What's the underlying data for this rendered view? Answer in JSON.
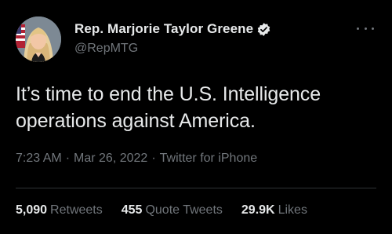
{
  "tweet": {
    "author": {
      "display_name": "Rep. Marjorie Taylor Greene",
      "handle": "@RepMTG",
      "verified_icon": "verified-badge-icon",
      "avatar_icon": "profile-photo"
    },
    "more_icon": "more-options-icon",
    "text": "It’s time to end the U.S. Intelligence operations against America.",
    "meta": {
      "time": "7:23 AM",
      "date": "Mar 26, 2022",
      "source": "Twitter for iPhone",
      "separator": "·"
    },
    "stats": [
      {
        "count": "5,090",
        "label": "Retweets"
      },
      {
        "count": "455",
        "label": "Quote Tweets"
      },
      {
        "count": "29.9K",
        "label": "Likes"
      }
    ]
  },
  "colors": {
    "background": "#000000",
    "primary_text": "#e7e9ea",
    "secondary_text": "#71767b",
    "divider": "#2f3336"
  }
}
